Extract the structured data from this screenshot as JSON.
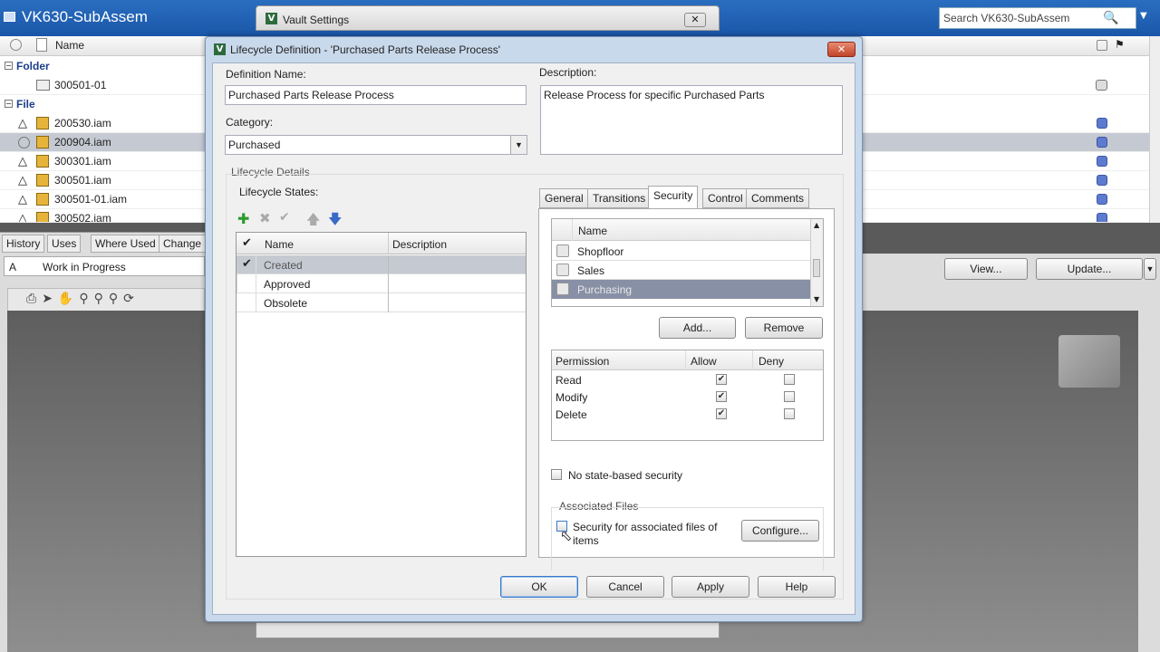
{
  "app": {
    "title": "VK630-SubAssem",
    "search_placeholder": "Search VK630-SubAssem"
  },
  "list": {
    "col_name": "Name",
    "groups": {
      "folder": "Folder",
      "file": "File"
    },
    "folder_items": [
      "300501-01"
    ],
    "files": [
      "200530.iam",
      "200904.iam",
      "300301.iam",
      "300501.iam",
      "300501-01.iam",
      "300502.iam"
    ],
    "selected_file": "200904.iam"
  },
  "bottom_tabs": [
    "History",
    "Uses",
    "Where Used",
    "Change"
  ],
  "state_row": {
    "rev": "A",
    "state": "Work in Progress"
  },
  "bottom_buttons": {
    "view": "View...",
    "update": "Update..."
  },
  "vault_settings": {
    "title": "Vault Settings"
  },
  "dialog": {
    "title": "Lifecycle Definition - 'Purchased Parts Release Process'",
    "definition_name_label": "Definition Name:",
    "definition_name_value": "Purchased Parts Release Process",
    "description_label": "Description:",
    "description_value": "Release Process for specific Purchased Parts",
    "category_label": "Category:",
    "category_value": "Purchased",
    "lifecycle_details": "Lifecycle Details",
    "lifecycle_states_label": "Lifecycle States:",
    "states_cols": {
      "name": "Name",
      "description": "Description"
    },
    "states": [
      {
        "name": "Created",
        "checked": true,
        "selected": true
      },
      {
        "name": "Approved",
        "checked": false,
        "selected": false
      },
      {
        "name": "Obsolete",
        "checked": false,
        "selected": false
      }
    ],
    "tabs": [
      "General",
      "Transitions",
      "Security",
      "Control",
      "Comments"
    ],
    "active_tab": "Security",
    "members_col": "Name",
    "members": [
      "Shopfloor",
      "Sales",
      "Purchasing"
    ],
    "selected_member": "Purchasing",
    "add_btn": "Add...",
    "remove_btn": "Remove",
    "perm_cols": {
      "permission": "Permission",
      "allow": "Allow",
      "deny": "Deny"
    },
    "permissions": [
      {
        "name": "Read",
        "allow": true,
        "deny": false
      },
      {
        "name": "Modify",
        "allow": true,
        "deny": false
      },
      {
        "name": "Delete",
        "allow": true,
        "deny": false
      }
    ],
    "no_state_security": "No state-based security",
    "assoc_files": "Associated Files",
    "assoc_security": "Security for associated files of items",
    "configure_btn": "Configure...",
    "ok": "OK",
    "cancel": "Cancel",
    "apply": "Apply",
    "help": "Help"
  }
}
